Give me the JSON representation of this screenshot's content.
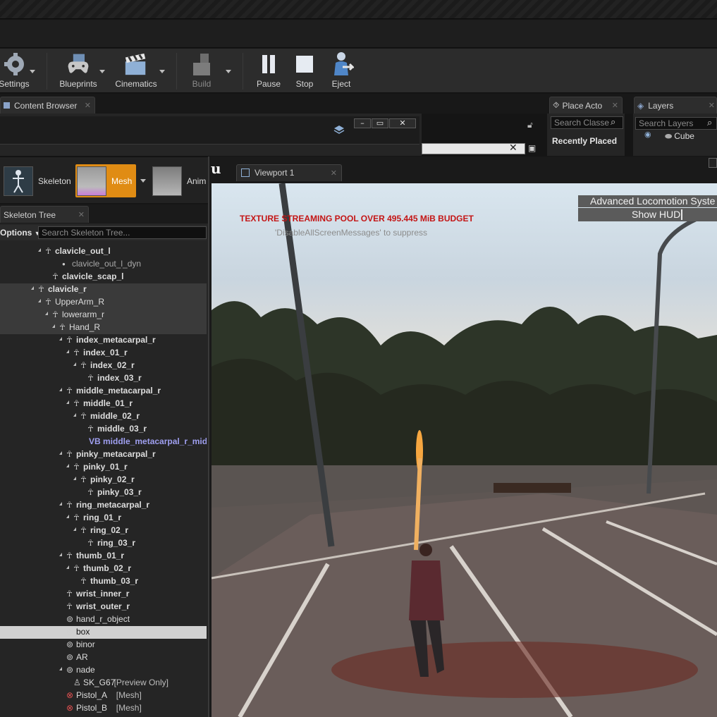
{
  "toolbar": {
    "settings_label": "Settings",
    "blueprints_label": "Blueprints",
    "cinematics_label": "Cinematics",
    "build_label": "Build",
    "pause_label": "Pause",
    "stop_label": "Stop",
    "eject_label": "Eject"
  },
  "tabs": {
    "content_browser": "Content Browser",
    "place_actors": "Place Acto",
    "layers": "Layers",
    "skeleton_tree": "Skeleton Tree",
    "viewport": "Viewport 1"
  },
  "place_actors": {
    "search_placeholder": "Search Classe",
    "recently_placed": "Recently Placed"
  },
  "layers": {
    "search_placeholder": "Search Layers",
    "items": [
      "Cube"
    ]
  },
  "asset_modes": {
    "skeleton": "Skeleton",
    "mesh": "Mesh",
    "animation": "Anim"
  },
  "skeleton_tree": {
    "options_label": "Options",
    "search_placeholder": "Search Skeleton Tree...",
    "rows": [
      {
        "label": "clavicle_out_l",
        "kind": "bone"
      },
      {
        "label": "clavicle_out_l_dyn",
        "kind": "socket"
      },
      {
        "label": "clavicle_scap_l",
        "kind": "bone"
      },
      {
        "label": "clavicle_r",
        "kind": "bone"
      },
      {
        "label": "UpperArm_R",
        "kind": "bone"
      },
      {
        "label": "lowerarm_r",
        "kind": "bone"
      },
      {
        "label": "Hand_R",
        "kind": "bone"
      },
      {
        "label": "index_metacarpal_r",
        "kind": "bone"
      },
      {
        "label": "index_01_r",
        "kind": "bone"
      },
      {
        "label": "index_02_r",
        "kind": "bone"
      },
      {
        "label": "index_03_r",
        "kind": "bone"
      },
      {
        "label": "middle_metacarpal_r",
        "kind": "bone"
      },
      {
        "label": "middle_01_r",
        "kind": "bone"
      },
      {
        "label": "middle_02_r",
        "kind": "bone"
      },
      {
        "label": "middle_03_r",
        "kind": "bone"
      },
      {
        "label": "VB middle_metacarpal_r_mid",
        "kind": "virtual"
      },
      {
        "label": "pinky_metacarpal_r",
        "kind": "bone"
      },
      {
        "label": "pinky_01_r",
        "kind": "bone"
      },
      {
        "label": "pinky_02_r",
        "kind": "bone"
      },
      {
        "label": "pinky_03_r",
        "kind": "bone"
      },
      {
        "label": "ring_metacarpal_r",
        "kind": "bone"
      },
      {
        "label": "ring_01_r",
        "kind": "bone"
      },
      {
        "label": "ring_02_r",
        "kind": "bone"
      },
      {
        "label": "ring_03_r",
        "kind": "bone"
      },
      {
        "label": "thumb_01_r",
        "kind": "bone"
      },
      {
        "label": "thumb_02_r",
        "kind": "bone"
      },
      {
        "label": "thumb_03_r",
        "kind": "bone"
      },
      {
        "label": "wrist_inner_r",
        "kind": "bone"
      },
      {
        "label": "wrist_outer_r",
        "kind": "bone"
      },
      {
        "label": "hand_r_object",
        "kind": "socket"
      },
      {
        "label": "box",
        "kind": "socket"
      },
      {
        "label": "binor",
        "kind": "socket"
      },
      {
        "label": "AR",
        "kind": "socket"
      },
      {
        "label": "nade",
        "kind": "socket"
      },
      {
        "label": "SK_G67",
        "kind": "preview",
        "suffix": "[Preview Only]"
      },
      {
        "label": "Pistol_A",
        "kind": "mesh",
        "suffix": "[Mesh]"
      },
      {
        "label": "Pistol_B",
        "kind": "mesh",
        "suffix": "[Mesh]"
      }
    ]
  },
  "viewport": {
    "warning": "TEXTURE STREAMING POOL OVER 495.445 MiB BUDGET",
    "suppress_hint": "'DisableAllScreenMessages' to suppress",
    "hud_title": "Advanced Locomotion Syste",
    "hud_button": "Show HUD"
  },
  "colors": {
    "accent": "#e08c14",
    "warning_text": "#c41515",
    "virtual_bone": "#9f9ff0"
  }
}
